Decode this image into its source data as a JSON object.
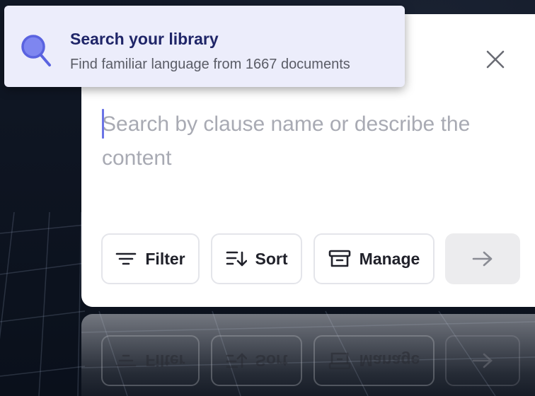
{
  "tooltip": {
    "icon": "search-icon",
    "title": "Search your library",
    "subtitle": "Find familiar language from 1667 documents"
  },
  "search": {
    "placeholder": "Search by clause name or describe the content"
  },
  "toolbar": {
    "filter_label": "Filter",
    "sort_label": "Sort",
    "manage_label": "Manage",
    "submit_icon": "arrow-right-icon"
  },
  "colors": {
    "accent": "#6b74e6",
    "tooltip_bg": "#ecedfb",
    "tooltip_title": "#1f2568"
  }
}
